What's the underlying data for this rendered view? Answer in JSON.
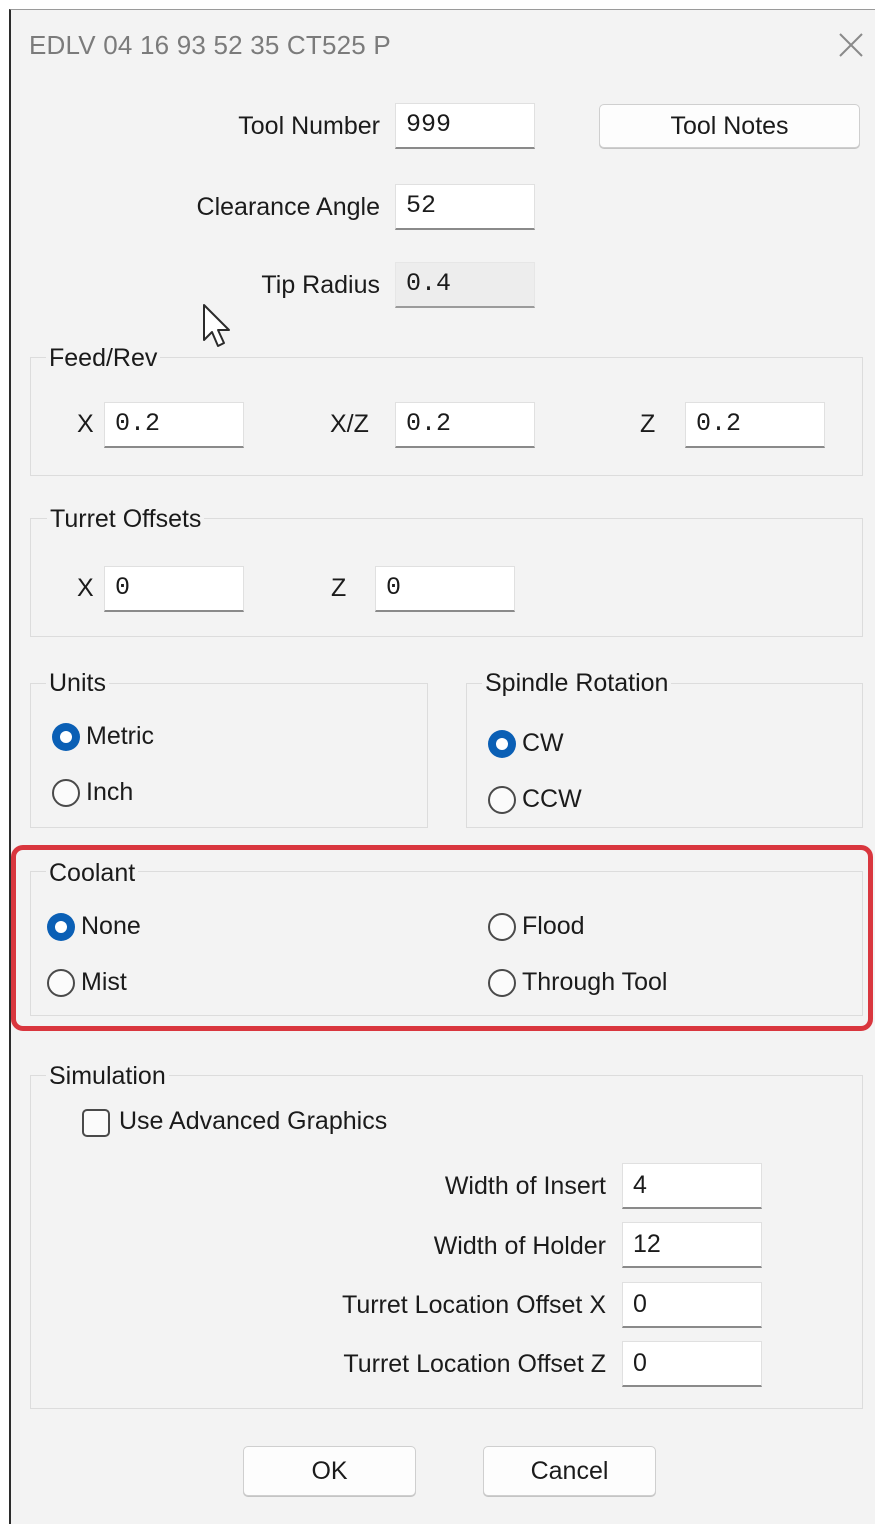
{
  "window": {
    "title": "EDLV 04 16 93 52 35 CT525 P",
    "close_icon": "close-icon"
  },
  "tool": {
    "tool_number_label": "Tool Number",
    "tool_number_value": "999",
    "tool_notes_label": "Tool Notes",
    "clearance_angle_label": "Clearance Angle",
    "clearance_angle_value": "52",
    "tip_radius_label": "Tip Radius",
    "tip_radius_value": "0.4"
  },
  "feed_rev": {
    "title": "Feed/Rev",
    "x_label": "X",
    "x_value": "0.2",
    "xz_label": "X/Z",
    "xz_value": "0.2",
    "z_label": "Z",
    "z_value": "0.2"
  },
  "turret_offsets": {
    "title": "Turret Offsets",
    "x_label": "X",
    "x_value": "0",
    "z_label": "Z",
    "z_value": "0"
  },
  "units": {
    "title": "Units",
    "options": [
      {
        "label": "Metric",
        "selected": true
      },
      {
        "label": "Inch",
        "selected": false
      }
    ]
  },
  "spindle_rotation": {
    "title": "Spindle Rotation",
    "options": [
      {
        "label": "CW",
        "selected": true
      },
      {
        "label": "CCW",
        "selected": false
      }
    ]
  },
  "coolant": {
    "title": "Coolant",
    "options": [
      {
        "label": "None",
        "selected": true
      },
      {
        "label": "Mist",
        "selected": false
      },
      {
        "label": "Flood",
        "selected": false
      },
      {
        "label": "Through Tool",
        "selected": false
      }
    ],
    "highlight_color": "#d9363e"
  },
  "simulation": {
    "title": "Simulation",
    "advanced_graphics_label": "Use Advanced Graphics",
    "advanced_graphics_checked": false,
    "width_of_insert_label": "Width of Insert",
    "width_of_insert_value": "4",
    "width_of_holder_label": "Width of Holder",
    "width_of_holder_value": "12",
    "turret_offset_x_label": "Turret Location Offset X",
    "turret_offset_x_value": "0",
    "turret_offset_z_label": "Turret Location Offset Z",
    "turret_offset_z_value": "0"
  },
  "buttons": {
    "ok_label": "OK",
    "cancel_label": "Cancel"
  },
  "colors": {
    "accent": "#0a5fb5",
    "dialog_bg": "#f3f3f3"
  }
}
